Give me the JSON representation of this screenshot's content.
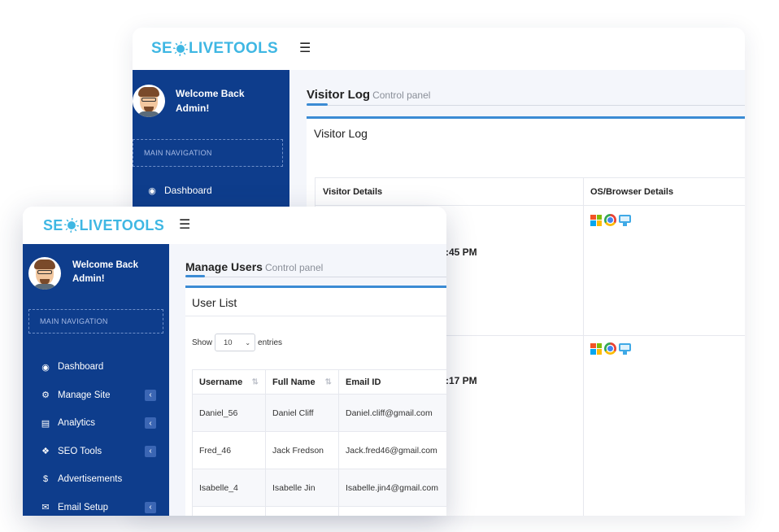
{
  "brand": {
    "logo_pre": "SE",
    "logo_post": "LIVETOOLS",
    "accent": "#3fb7e3",
    "sidebar_bg": "#0e3d8c"
  },
  "back_window": {
    "welcome_line1": "Welcome Back",
    "welcome_line2": "Admin!",
    "nav_header": "MAIN NAVIGATION",
    "nav_items": [
      {
        "label": "Dashboard",
        "icon": "dashboard-icon"
      }
    ],
    "page_title": "Visitor Log",
    "page_subtitle": "Control panel",
    "box_title": "Visitor Log",
    "columns": [
      "Visitor Details",
      "OS/Browser Details"
    ],
    "rows": [
      {
        "time_fragment": ":45 PM",
        "icons": [
          "windows-icon",
          "chrome-icon",
          "desktop-icon"
        ]
      },
      {
        "time_fragment": ":17 PM",
        "icons": [
          "windows-icon",
          "chrome-icon",
          "desktop-icon"
        ]
      }
    ]
  },
  "front_window": {
    "welcome_line1": "Welcome Back",
    "welcome_line2": "Admin!",
    "nav_header": "MAIN NAVIGATION",
    "nav_items": [
      {
        "label": "Dashboard",
        "icon": "dashboard-icon",
        "has_submenu": false
      },
      {
        "label": "Manage Site",
        "icon": "cogs-icon",
        "has_submenu": true
      },
      {
        "label": "Analytics",
        "icon": "bar-chart-icon",
        "has_submenu": true
      },
      {
        "label": "SEO Tools",
        "icon": "cube-icon",
        "has_submenu": true
      },
      {
        "label": "Advertisements",
        "icon": "dollar-icon",
        "has_submenu": false
      },
      {
        "label": "Email Setup",
        "icon": "envelope-icon",
        "has_submenu": true
      }
    ],
    "page_title": "Manage Users",
    "page_subtitle": "Control panel",
    "box_title": "User List",
    "show_label": "Show",
    "entries_value": "10",
    "entries_label": "entries",
    "columns": [
      "Username",
      "Full Name",
      "Email ID"
    ],
    "rows": [
      {
        "username": "Daniel_56",
        "full_name": "Daniel Cliff",
        "email": "Daniel.cliff@gmail.com"
      },
      {
        "username": "Fred_46",
        "full_name": "Jack Fredson",
        "email": "Jack.fred46@gmail.com"
      },
      {
        "username": "Isabelle_4",
        "full_name": "Isabelle Jin",
        "email": "Isabelle.jin4@gmail.com"
      }
    ]
  }
}
